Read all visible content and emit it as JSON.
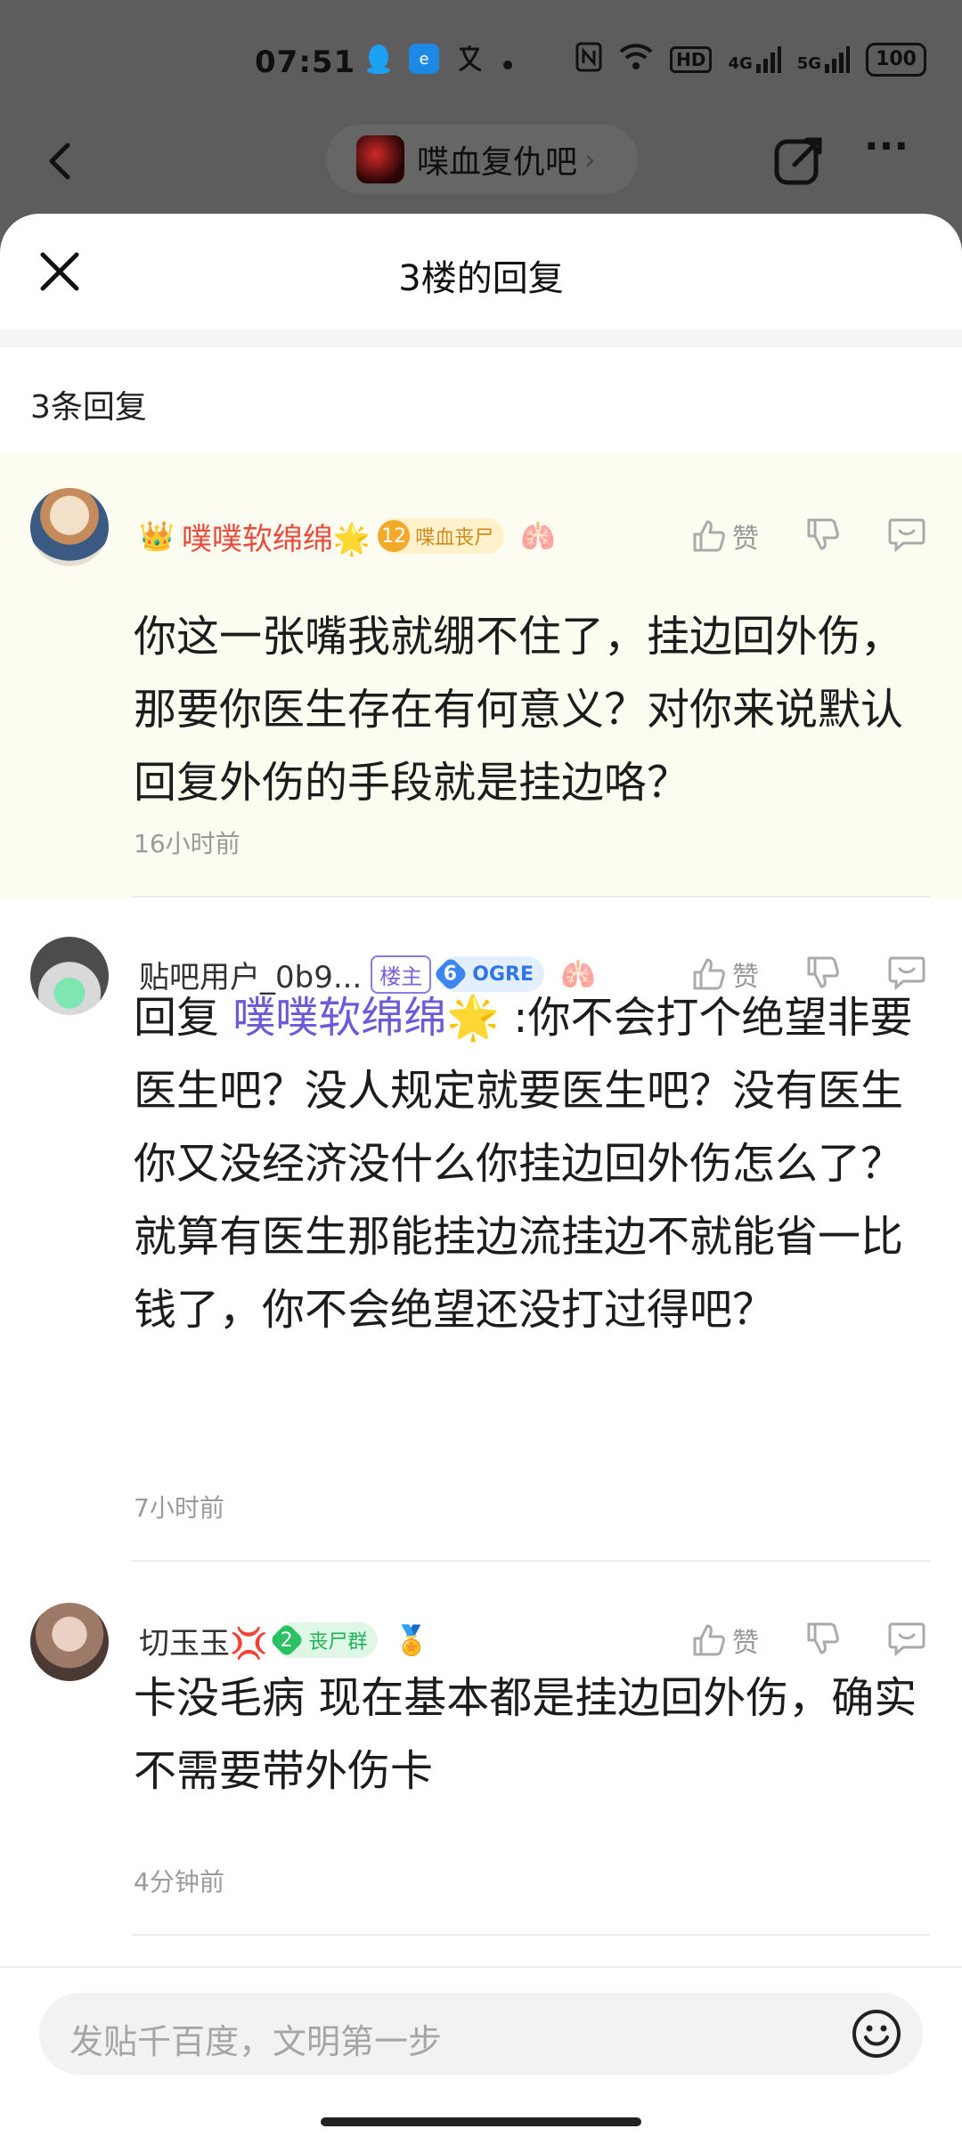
{
  "status_bar": {
    "time": "07:51",
    "icons": [
      "qq-icon",
      "app-icon",
      "translate-icon",
      "dot-icon"
    ],
    "right_icons": [
      "nfc-icon",
      "wifi-icon",
      "hd-icon",
      "4g-signal-icon",
      "5g-signal-icon"
    ],
    "hd_label": "HD",
    "sig4g": "4G",
    "sig5g": "5G",
    "battery": "100"
  },
  "top_nav": {
    "forum_name": "喋血复仇吧",
    "chevron": "›",
    "more": "···"
  },
  "sheet": {
    "title": "3楼的回复",
    "reply_count": "3条回复"
  },
  "replies": [
    {
      "username": "噗噗软绵绵🌟",
      "crown": "👑",
      "level": "12",
      "badge": "喋血丧尸",
      "deco": "🫁",
      "like_label": "赞",
      "text": "你这一张嘴我就绷不住了，挂边回外伤，那要你医生存在有何意义？对你来说默认回复外伤的手段就是挂边咯？",
      "time": "16小时前"
    },
    {
      "username": "贴吧用户_0b9...",
      "owner_tag": "楼主",
      "level": "6",
      "badge": "OGRE",
      "deco": "🫁",
      "like_label": "赞",
      "reply_prefix": "回复 ",
      "mention": "噗噗软绵绵🌟",
      "text": " :你不会打个绝望非要医生吧？没人规定就要医生吧？没有医生你又没经济没什么你挂边回外伤怎么了？就算有医生那能挂边流挂边不就能省一比钱了，你不会绝望还没打过得吧？",
      "time": "7小时前"
    },
    {
      "username": "切玉玉💢",
      "level": "2",
      "badge": "丧尸群",
      "deco": "🏅",
      "like_label": "赞",
      "text": "卡没毛病 现在基本都是挂边回外伤，确实不需要带外伤卡",
      "time": "4分钟前"
    }
  ],
  "composer": {
    "placeholder": "发贴千百度，文明第一步"
  }
}
